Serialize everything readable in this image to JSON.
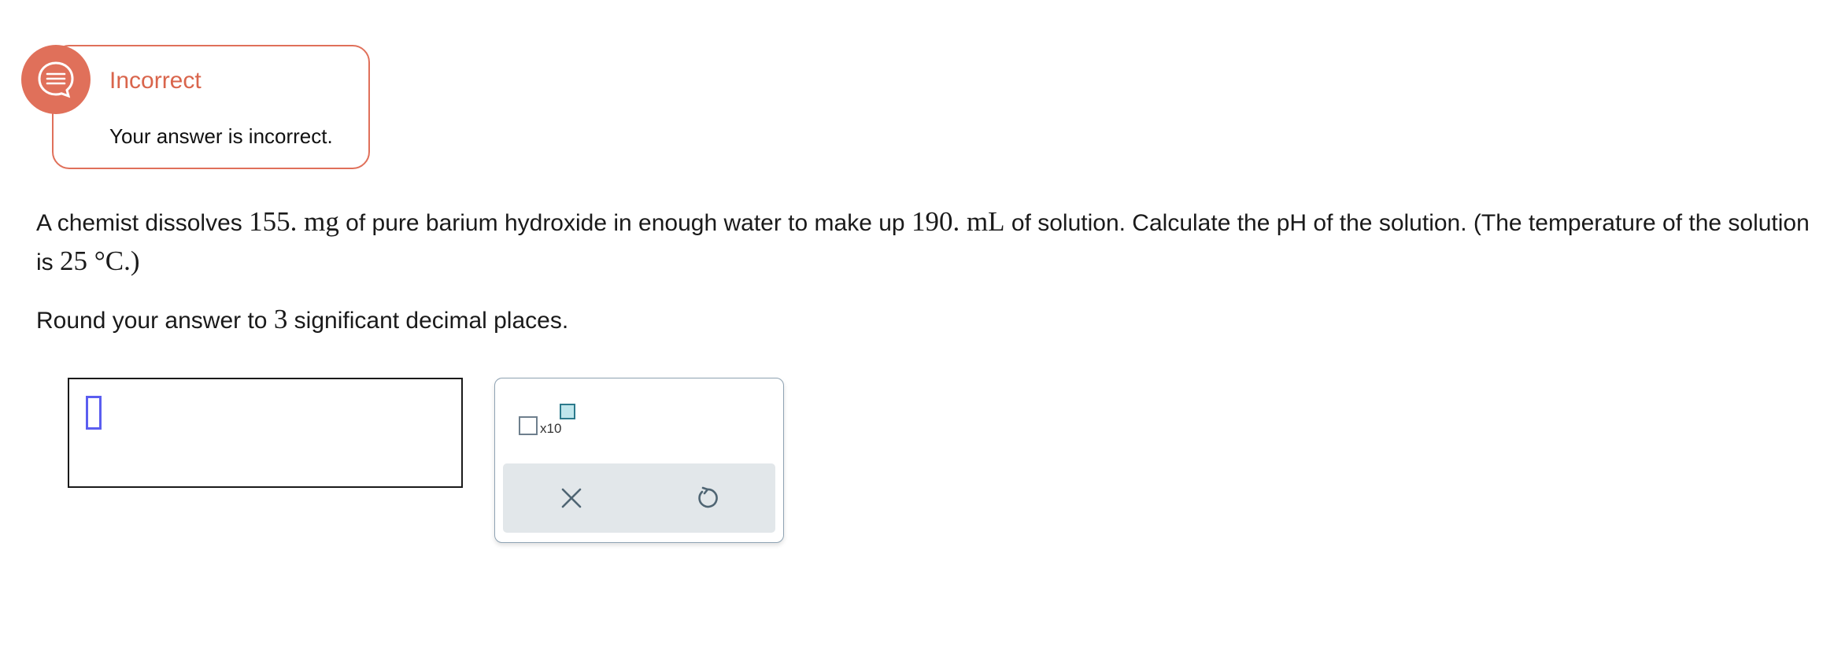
{
  "feedback": {
    "title": "Incorrect",
    "message": "Your answer is incorrect.",
    "icon": "chat-bubble-icon",
    "color": "#e0705a"
  },
  "question": {
    "p1": "A chemist dissolves ",
    "mass": "155.",
    "mass_unit": " mg",
    "p2": " of pure barium hydroxide in enough water to make up ",
    "volume": "190.",
    "volume_unit": " mL",
    "p3": " of solution. Calculate the pH of the solution. (The temperature of the solution is ",
    "temperature": "25 °C",
    "p4": ".)"
  },
  "instruction": {
    "p1": "Round your answer to ",
    "places": "3",
    "p2": " significant decimal places."
  },
  "answer": {
    "value": ""
  },
  "tools": {
    "x10_label": "x10",
    "clear_icon": "close-icon",
    "undo_icon": "undo-icon"
  }
}
